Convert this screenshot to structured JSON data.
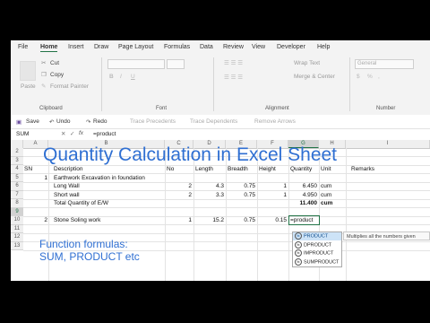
{
  "menu": [
    "File",
    "Home",
    "Insert",
    "Draw",
    "Page Layout",
    "Formulas",
    "Data",
    "Review",
    "View",
    "Developer",
    "Help"
  ],
  "ribbon": {
    "cut": "Cut",
    "copy": "Copy",
    "paste": "Paste",
    "format_painter": "Format Painter",
    "clipboard": "Clipboard",
    "font": "Font",
    "wrap_text": "Wrap Text",
    "merge_center": "Merge & Center",
    "alignment": "Alignment",
    "number_format": "General",
    "number": "Number",
    "currency": "$",
    "percent": "%",
    "comma": ",",
    "bold_btn": "B",
    "italic_btn": "I",
    "underline_btn": "U"
  },
  "qat": {
    "save": "Save",
    "undo": "Undo",
    "redo": "Redo",
    "trace_precedents": "Trace Precedents",
    "trace_dependents": "Trace Dependents",
    "remove_arrows": "Remove Arrows"
  },
  "formula_bar": {
    "name_box": "SUM",
    "formula": "=product",
    "fx": "fx"
  },
  "columns": [
    "A",
    "B",
    "C",
    "D",
    "E",
    "F",
    "G",
    "H",
    "I"
  ],
  "rows": [
    "2",
    "3",
    "4",
    "5",
    "6",
    "7",
    "8",
    "9",
    "10",
    "11",
    "12",
    "13"
  ],
  "title": "Quantity Calculation in Excel Sheet",
  "note_line1": "Function formulas:",
  "note_line2": "SUM, PRODUCT etc",
  "cells": {
    "sn_header": "SN",
    "description_header": "Description",
    "no_header": "No",
    "length_header": "Length",
    "breadth_header": "Breadth",
    "height_header": "Height",
    "quantity_header": "Quantity",
    "unit_header": "Unit",
    "remarks_header": "Remarks",
    "r5_sn": "1",
    "r5_desc": "Earthwork Excavation in foundation",
    "r6_desc": "Long Wall",
    "r6_no": "2",
    "r6_len": "4.3",
    "r6_br": "0.75",
    "r6_ht": "1",
    "r6_qty": "6.450",
    "r6_unit": "cum",
    "r7_desc": "Short wall",
    "r7_no": "2",
    "r7_len": "3.3",
    "r7_br": "0.75",
    "r7_ht": "1",
    "r7_qty": "4.950",
    "r7_unit": "cum",
    "r8_desc": "Total Quantity of E/W",
    "r8_qty": "11.400",
    "r8_unit": "cum",
    "r9_sn": "2",
    "r9_desc": "Stone Soling work",
    "r9_no": "1",
    "r9_len": "15.2",
    "r9_br": "0.75",
    "r9_ht": "0.15",
    "r9_qty": "=product"
  },
  "autocomplete": {
    "items": [
      "PRODUCT",
      "DPRODUCT",
      "IMPRODUCT",
      "SUMPRODUCT"
    ],
    "tooltip": "Multiplies all the numbers given",
    "fx_glyph": "fx"
  }
}
